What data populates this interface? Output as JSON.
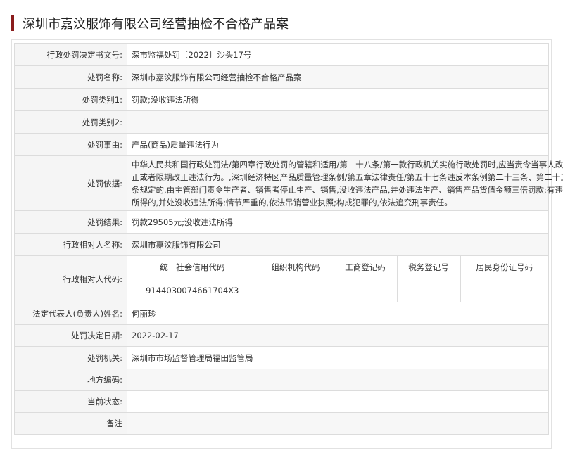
{
  "title": "深圳市嘉汶服饰有限公司经营抽检不合格产品案",
  "rows": {
    "doc_no": {
      "label": "行政处罚决定书文号:",
      "value": "深市监福处罚〔2022〕沙头17号"
    },
    "case_name": {
      "label": "处罚名称:",
      "value": "深圳市嘉汶服饰有限公司经营抽检不合格产品案"
    },
    "category1": {
      "label": "处罚类别1:",
      "value": "罚款;没收违法所得"
    },
    "category2": {
      "label": "处罚类别2:",
      "value": ""
    },
    "reason": {
      "label": "处罚事由:",
      "value": "产品(商品)质量违法行为"
    },
    "basis": {
      "label": "处罚依据:",
      "line1": "中华人民共和国行政处罚法/第四章行政处罚的管辖和适用/第二十八条/第一款行政机关实施行政处罚时,应当责令当事人改",
      "line2": "正或者限期改正违法行为。,深圳经济特区产品质量管理条例/第五章法律责任/第五十七条违反本条例第二十三条、第二十五",
      "line3": "条规定的,由主管部门责令生产者、销售者停止生产、销售,没收违法产品,并处违法生产、销售产品货值金额三倍罚款;有违法",
      "line4": "所得的,并处没收违法所得;情节严重的,依法吊销营业执照;构成犯罪的,依法追究刑事责任。"
    },
    "result": {
      "label": "处罚结果:",
      "value": "罚款29505元;没收违法所得"
    },
    "party_name": {
      "label": "行政相对人名称:",
      "value": "深圳市嘉汶服饰有限公司"
    },
    "party_code": {
      "label": "行政相对人代码:",
      "headers": [
        "统一社会信用代码",
        "组织机构代码",
        "工商登记码",
        "税务登记号",
        "居民身份证号码"
      ],
      "values": [
        "9144030074661704X3",
        "",
        "",
        "",
        ""
      ]
    },
    "legal_rep": {
      "label": "法定代表人(负责人)姓名:",
      "value": "何丽珍"
    },
    "decision_date": {
      "label": "处罚决定日期:",
      "value": "2022-02-17"
    },
    "authority": {
      "label": "处罚机关:",
      "value": "深圳市市场监督管理局福田监管局"
    },
    "region_code": {
      "label": "地方编码:",
      "value": ""
    },
    "status": {
      "label": "当前状态:",
      "value": ""
    },
    "remark": {
      "label": "备注",
      "value": ""
    }
  },
  "colors": {
    "accent": "#8a1c1c",
    "label_bg": "#f5f5f5",
    "border": "#dcdcdc"
  }
}
